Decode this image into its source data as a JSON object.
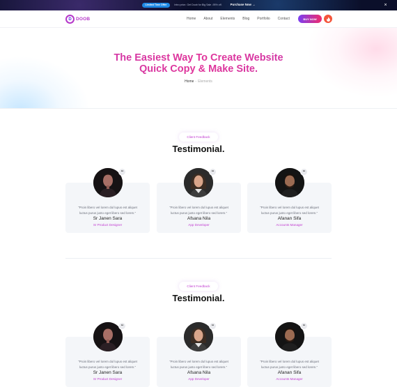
{
  "promo": {
    "badge": "Limited Time Offer",
    "message": "Intro price. Get Doob for Big Sale -95% off.",
    "cta": "Purchase Now →",
    "close": "×"
  },
  "header": {
    "logo_letter": "D",
    "logo_text": "DOOB",
    "nav": [
      "Home",
      "About",
      "Elements",
      "Blog",
      "Portfolio",
      "Contact"
    ],
    "buy_label": "BUY NOW",
    "fire_icon": "🔥"
  },
  "hero": {
    "title_line1": "The Easiest Way To Create Website",
    "title_line2": "Quick Copy & Make Site.",
    "breadcrumb_home": "Home",
    "breadcrumb_sep": "-",
    "breadcrumb_current": "Elements"
  },
  "sections": [
    {
      "tagline": "Client Feedback",
      "title": "Testimonial.",
      "cards": [
        {
          "quote_mark": "“",
          "text_line1": "“Proin libero vel lorem dul lupus est aliquet",
          "text_line2": "luctus purus justo eget libero sed lorem.”",
          "name": "Sr Janen Sara",
          "role": "Sr Product Designer"
        },
        {
          "quote_mark": "“",
          "text_line1": "“Proin libero vel lorem dul lupus est aliquet",
          "text_line2": "luctus purus justo eget libero sed lorem.”",
          "name": "Afsana Nila",
          "role": "App Developer"
        },
        {
          "quote_mark": "“",
          "text_line1": "“Proin libero vel lorem dul lupus est aliquet",
          "text_line2": "luctus purus justo eget libero sed lorem.”",
          "name": "Afanan Sifa",
          "role": "Accounts Manager"
        }
      ]
    },
    {
      "tagline": "Client Feedback",
      "title": "Testimonial.",
      "cards": [
        {
          "quote_mark": "“",
          "text_line1": "“Proin libero vel lorem dul lupus est aliquet",
          "text_line2": "luctus purus justo eget libero sed lorem.”",
          "name": "Sr Janen Sara",
          "role": "Sr Product Designer"
        },
        {
          "quote_mark": "“",
          "text_line1": "“Proin libero vel lorem dul lupus est aliquet",
          "text_line2": "luctus purus justo eget libero sed lorem.”",
          "name": "Afsana Nila",
          "role": "App Developer"
        },
        {
          "quote_mark": "“",
          "text_line1": "“Proin libero vel lorem dul lupus est aliquet",
          "text_line2": "luctus purus justo eget libero sed lorem.”",
          "name": "Afanan Sifa",
          "role": "Accounts Manager"
        }
      ]
    }
  ],
  "colors": {
    "accent": "#c03ad0",
    "buy_gradient_start": "#7a3ff2",
    "buy_gradient_end": "#f12b6b",
    "promo_bg": "#0b0f2a",
    "card_bg": "#f4f6f9"
  }
}
